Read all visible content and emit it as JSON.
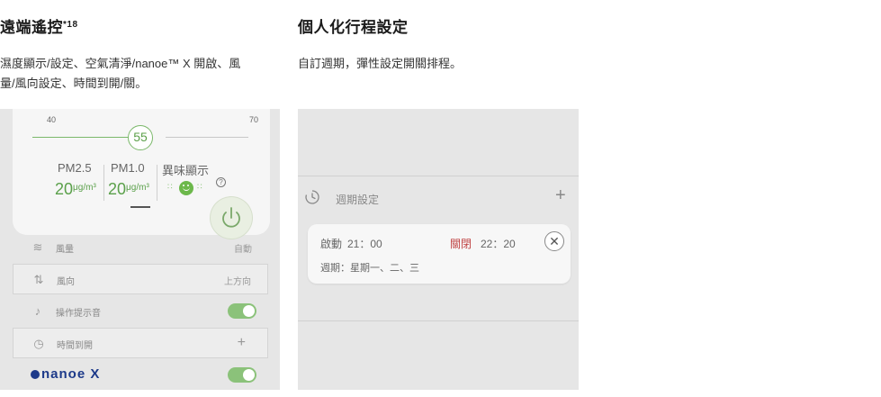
{
  "remote_section": {
    "title": "遠端遙控",
    "footnote": "*18",
    "desc_line1": "濕度顯示/設定、空氣清淨/nanoe™ X 開啟、風",
    "desc_line2": "量/風向設定、時間到開/關。"
  },
  "schedule_section": {
    "title": "個人化行程設定",
    "desc": "自訂週期，彈性設定開關排程。"
  },
  "left_app": {
    "slider": {
      "min": "40",
      "max": "70",
      "value": "55"
    },
    "metrics": [
      {
        "label": "PM2.5",
        "value": "20",
        "unit": "μg/m³"
      },
      {
        "label": "PM1.0",
        "value": "20",
        "unit": "μg/m³"
      },
      {
        "label": "異味顯示",
        "icon": "smiley-icon"
      }
    ],
    "help_symbol": "?",
    "power_icon": "power-icon",
    "rows": [
      {
        "icon": "airflow-icon",
        "glyph": "≋",
        "label": "風量",
        "value": "自動"
      },
      {
        "icon": "direction-icon",
        "glyph": "⇅",
        "label": "風向",
        "value": "上方向"
      },
      {
        "icon": "music-note-icon",
        "glyph": "♪",
        "label": "操作提示音",
        "toggle": true
      },
      {
        "icon": "clock-icon",
        "glyph": "◷",
        "label": "時間到開",
        "action": "+"
      }
    ],
    "nanoe": {
      "text": "nanoe X",
      "toggle": true
    },
    "colors": {
      "accent_green": "#8bc27a",
      "brand_blue": "#1d3a8a"
    }
  },
  "right_app": {
    "schedule_header": {
      "label": "週期設定",
      "add": "+"
    },
    "schedule_card": {
      "on_label": "啟動",
      "on_time": "21：00",
      "off_label": "關閉",
      "off_time": "22：20",
      "weekdays": "週期：星期一、二、三",
      "close": "✕"
    },
    "colors": {
      "off_red": "#c04545"
    }
  }
}
